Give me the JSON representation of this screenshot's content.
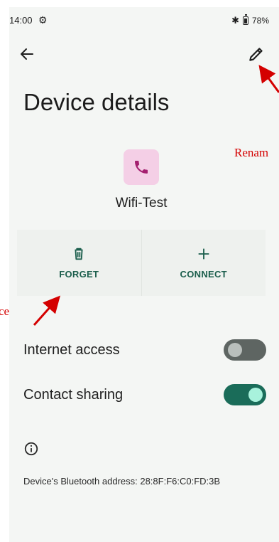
{
  "status_bar": {
    "time": "14:00",
    "battery": "78%",
    "icons": [
      "gear-icon",
      "bluetooth-icon",
      "battery-icon"
    ]
  },
  "app_bar": {
    "back_icon": "back-arrow-icon",
    "edit_icon": "pencil-icon"
  },
  "page": {
    "title": "Device details",
    "device_name": "Wifi-Test",
    "device_icon": "phone-icon",
    "device_icon_bg": "#f4cfe6",
    "device_icon_color": "#a4206f"
  },
  "actions": [
    {
      "label": "FORGET",
      "icon": "trash-icon"
    },
    {
      "label": "CONNECT",
      "icon": "plus-icon"
    }
  ],
  "settings": {
    "internet_access": {
      "label": "Internet access",
      "enabled": false
    },
    "contact_sharing": {
      "label": "Contact sharing",
      "enabled": true
    }
  },
  "footer": {
    "info_icon": "info-icon",
    "bt_address": "Device's Bluetooth address: 28:8F:F6:C0:FD:3B"
  },
  "annotations": {
    "rename": "Renam",
    "forget": "ce",
    "color": "#d40000"
  },
  "colors": {
    "accent": "#1b5e4c",
    "toggle_on": "#1a6c59",
    "toggle_off": "#5e6562",
    "background": "#f4f6f4"
  }
}
